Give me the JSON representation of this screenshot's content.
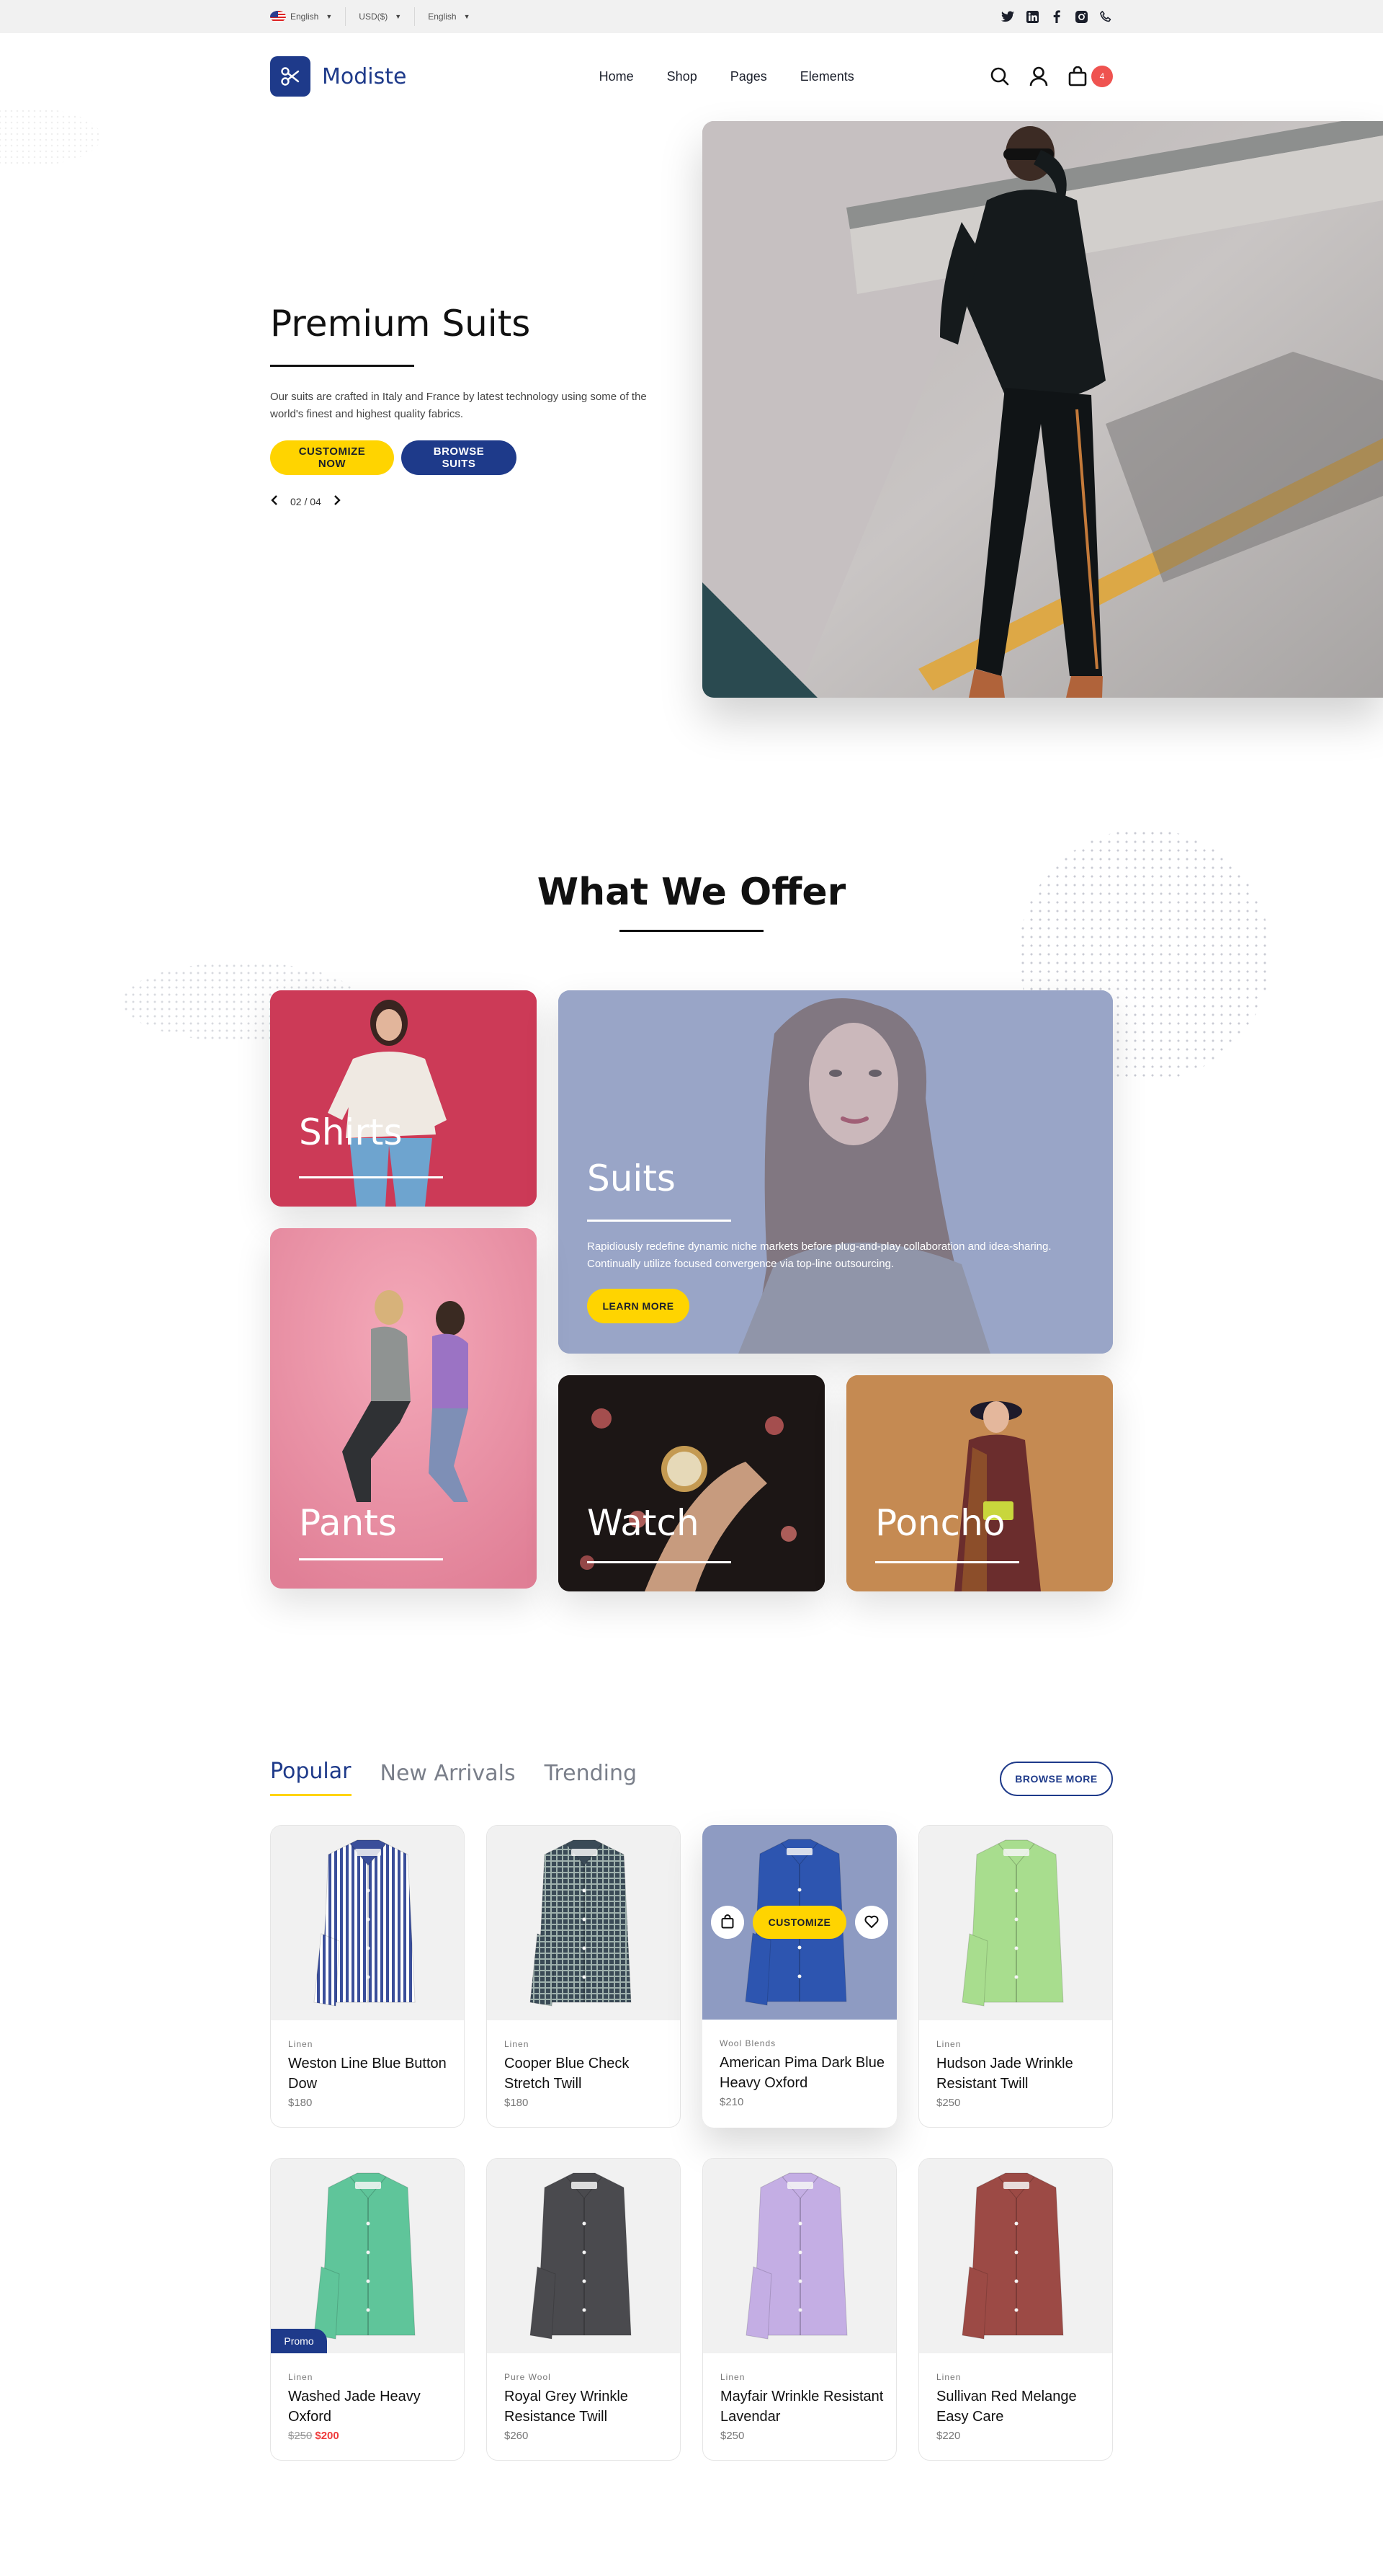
{
  "topbar": {
    "language": "English",
    "currency": "USD($)",
    "language2": "English",
    "social_icons": [
      "twitter-icon",
      "linkedin-icon",
      "facebook-icon",
      "instagram-icon",
      "phone-icon"
    ]
  },
  "header": {
    "brand": "Modiste",
    "nav": [
      "Home",
      "Shop",
      "Pages",
      "Elements"
    ],
    "cart_count": "4"
  },
  "hero": {
    "title": "Premium Suits",
    "description": "Our suits are crafted in Italy and France by latest technology using some of the world's finest and highest quality fabrics.",
    "primary_button": "CUSTOMIZE NOW",
    "secondary_button": "BROWSE SUITS",
    "pager": "02 / 04"
  },
  "offer": {
    "title": "What We Offer",
    "cards": {
      "shirts": "Shirts",
      "suits": "Suits",
      "suits_description": "Rapidiously redefine dynamic niche markets before plug-and-play collaboration and idea-sharing. Continually utilize focused convergence via top-line outsourcing.",
      "suits_button": "LEARN MORE",
      "pants": "Pants",
      "watch": "Watch",
      "poncho": "Poncho"
    }
  },
  "products": {
    "tabs": [
      "Popular",
      "New Arrivals",
      "Trending"
    ],
    "browse_more": "BROWSE MORE",
    "customize_label": "CUSTOMIZE",
    "promo_label": "Promo",
    "items": [
      {
        "category": "Linen",
        "name": "Weston Line Blue Button Dow",
        "price": "$180",
        "color": "#3a4e9a"
      },
      {
        "category": "Linen",
        "name": "Cooper Blue Check Stretch Twill",
        "price": "$180",
        "color": "#3a4a56"
      },
      {
        "category": "Wool Blends",
        "name": "American Pima Dark Blue Heavy Oxford",
        "price": "$210",
        "color": "#2d55b0"
      },
      {
        "category": "Linen",
        "name": "Hudson Jade Wrinkle Resistant Twill",
        "price": "$250",
        "color": "#a8dd8e"
      },
      {
        "category": "Linen",
        "name": "Washed Jade Heavy Oxford",
        "price_old": "$250",
        "price": "$200",
        "color": "#5fc59a"
      },
      {
        "category": "Pure Wool",
        "name": "Royal Grey Wrinkle Resistance Twill",
        "price": "$260",
        "color": "#4a4a4e"
      },
      {
        "category": "Linen",
        "name": "Mayfair Wrinkle Resistant Lavendar",
        "price": "$250",
        "color": "#c4aee4"
      },
      {
        "category": "Linen",
        "name": "Sullivan Red Melange Easy Care",
        "price": "$220",
        "color": "#9c4a45"
      }
    ]
  },
  "colors": {
    "navy": "#1e3a8a",
    "yellow": "#ffd400",
    "red": "#ef5350"
  }
}
